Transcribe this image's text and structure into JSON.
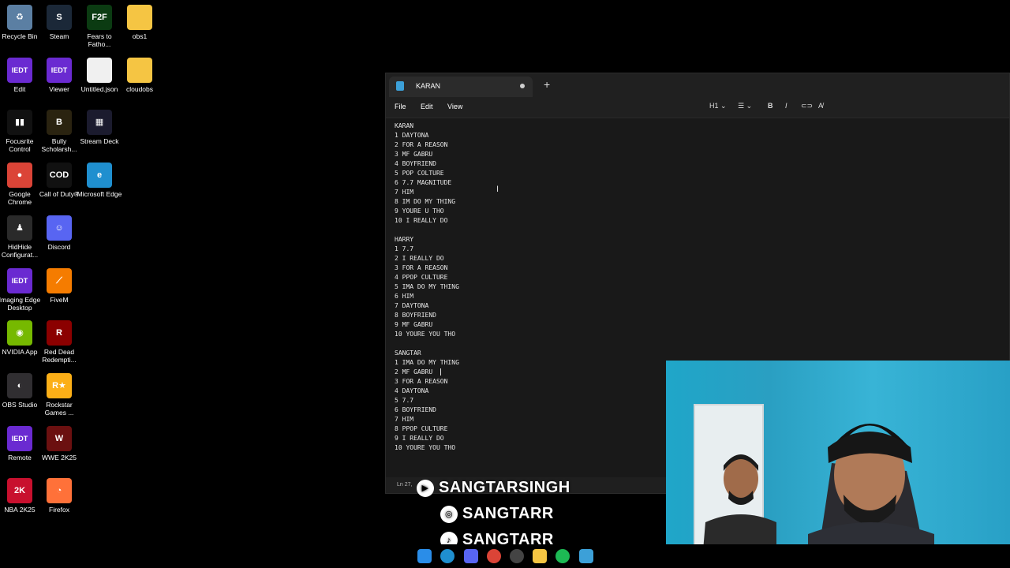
{
  "desktop": {
    "icons": [
      {
        "label": "Recycle Bin",
        "icon": "recycle-bin-icon",
        "color": "#5b7fa3",
        "glyph": "♻"
      },
      {
        "label": "Steam",
        "icon": "steam-icon",
        "color": "#1b2838",
        "glyph": "S"
      },
      {
        "label": "Fears to Fatho...",
        "icon": "fears-to-fathom-icon",
        "color": "#0b3b12",
        "glyph": "F2F"
      },
      {
        "label": "obs1",
        "icon": "folder-icon",
        "color": "#f5c543",
        "glyph": ""
      },
      {
        "label": "Edit",
        "icon": "iedt-icon",
        "color": "#6a2ad1",
        "glyph": "IEDT"
      },
      {
        "label": "Viewer",
        "icon": "iedt-icon",
        "color": "#6a2ad1",
        "glyph": "IEDT"
      },
      {
        "label": "Untitled.json",
        "icon": "file-icon",
        "color": "#f0f0f0",
        "glyph": ""
      },
      {
        "label": "cloudobs",
        "icon": "folder-icon",
        "color": "#f5c543",
        "glyph": ""
      },
      {
        "label": "Focusrite Control",
        "icon": "focusrite-icon",
        "color": "#111",
        "glyph": "▮▮"
      },
      {
        "label": "Bully Scholarsh...",
        "icon": "bully-icon",
        "color": "#2a2310",
        "glyph": "B"
      },
      {
        "label": "Stream Deck",
        "icon": "stream-deck-icon",
        "color": "#1b1b2e",
        "glyph": "▦"
      },
      {
        "label": "Google Chrome",
        "icon": "chrome-icon",
        "color": "#db4437",
        "glyph": "●"
      },
      {
        "label": "Call of Duty®",
        "icon": "call-of-duty-icon",
        "color": "#111",
        "glyph": "COD"
      },
      {
        "label": "Microsoft Edge",
        "icon": "edge-icon",
        "color": "#1f8fcf",
        "glyph": "e"
      },
      {
        "label": "HidHide Configurat...",
        "icon": "hidhide-icon",
        "color": "#2a2a2a",
        "glyph": "♟"
      },
      {
        "label": "Discord",
        "icon": "discord-icon",
        "color": "#5865f2",
        "glyph": "☺"
      },
      {
        "label": "Imaging Edge Desktop",
        "icon": "iedt-icon",
        "color": "#6a2ad1",
        "glyph": "IEDT"
      },
      {
        "label": "FiveM",
        "icon": "fivem-icon",
        "color": "#f57c00",
        "glyph": "⟋"
      },
      {
        "label": "NVIDIA App",
        "icon": "nvidia-icon",
        "color": "#76b900",
        "glyph": "◉"
      },
      {
        "label": "Red Dead Redempti...",
        "icon": "red-dead-icon",
        "color": "#8b0000",
        "glyph": "R"
      },
      {
        "label": "OBS Studio",
        "icon": "obs-icon",
        "color": "#302e31",
        "glyph": "◐"
      },
      {
        "label": "Rockstar Games ...",
        "icon": "rockstar-icon",
        "color": "#fcaf17",
        "glyph": "R★"
      },
      {
        "label": "Remote",
        "icon": "iedt-icon",
        "color": "#6a2ad1",
        "glyph": "IEDT"
      },
      {
        "label": "WWE 2K25",
        "icon": "wwe-icon",
        "color": "#6b1010",
        "glyph": "W"
      },
      {
        "label": "NBA 2K25",
        "icon": "nba-icon",
        "color": "#c8102e",
        "glyph": "2K"
      },
      {
        "label": "Firefox",
        "icon": "firefox-icon",
        "color": "#ff7139",
        "glyph": "◔"
      }
    ]
  },
  "notepad": {
    "tab_title": "KARAN",
    "new_tab": "+",
    "menu": {
      "file": "File",
      "edit": "Edit",
      "view": "View"
    },
    "toolbar": {
      "heading": "H1",
      "bold": "B",
      "italic": "I"
    },
    "lines": [
      "KARAN",
      "1 DAYTONA",
      "2 FOR A REASON",
      "3 MF GABRU",
      "4 BOYFRIEND",
      "5 POP COLTURE",
      "6 7.7 MAGNITUDE",
      "7 HIM",
      "8 IM DO MY THING",
      "9 YOURE U THO",
      "10 I REALLY DO",
      "",
      "HARRY",
      "1 7.7",
      "2 I REALLY DO",
      "3 FOR A REASON",
      "4 PPOP CULTURE",
      "5 IMA DO MY THING",
      "6 HIM",
      "7 DAYTONA",
      "8 BOYFRIEND",
      "9 MF GABRU",
      "10 YOURE YOU THO",
      "",
      "SANGTAR",
      "1 IMA DO MY THING",
      "2 MF GABRU",
      "3 FOR A REASON",
      "4 DAYTONA",
      "5 7.7",
      "6 BOYFRIEND",
      "7 HIM",
      "8 PPOP CULTURE",
      "9 I REALLY DO",
      "10 YOURE YOU THO"
    ],
    "status": "Ln 27,"
  },
  "overlay": {
    "youtube": "SANGTARSINGH",
    "instagram": "SANGTARR",
    "tiktok": "SANGTARR"
  }
}
